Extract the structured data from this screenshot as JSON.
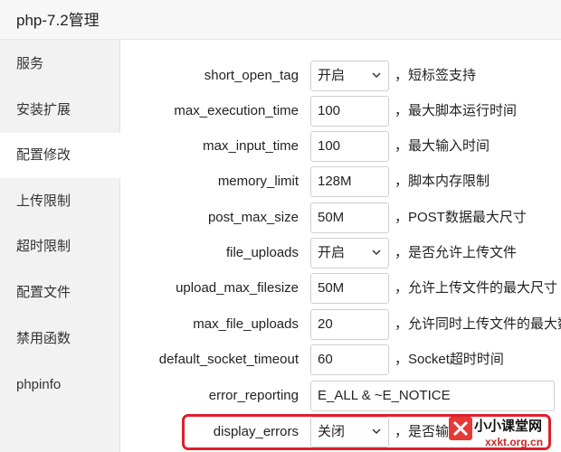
{
  "window": {
    "title": "php-7.2管理"
  },
  "sidebar": {
    "items": [
      {
        "label": "服务"
      },
      {
        "label": "安装扩展"
      },
      {
        "label": "配置修改",
        "active": true
      },
      {
        "label": "上传限制"
      },
      {
        "label": "超时限制"
      },
      {
        "label": "配置文件"
      },
      {
        "label": "禁用函数"
      },
      {
        "label": "phpinfo"
      }
    ]
  },
  "settings": [
    {
      "name": "short_open_tag",
      "value": "开启",
      "type": "select",
      "desc": "，短标签支持"
    },
    {
      "name": "max_execution_time",
      "value": "100",
      "type": "input",
      "desc": "，最大脚本运行时间"
    },
    {
      "name": "max_input_time",
      "value": "100",
      "type": "input",
      "desc": "，最大输入时间"
    },
    {
      "name": "memory_limit",
      "value": "128M",
      "type": "input",
      "desc": "，脚本内存限制"
    },
    {
      "name": "post_max_size",
      "value": "50M",
      "type": "input",
      "desc": "，POST数据最大尺寸"
    },
    {
      "name": "file_uploads",
      "value": "开启",
      "type": "select",
      "desc": "，是否允许上传文件"
    },
    {
      "name": "upload_max_filesize",
      "value": "50M",
      "type": "input",
      "desc": "，允许上传文件的最大尺寸"
    },
    {
      "name": "max_file_uploads",
      "value": "20",
      "type": "input",
      "desc": "，允许同时上传文件的最大数"
    },
    {
      "name": "default_socket_timeout",
      "value": "60",
      "type": "input",
      "desc": "，Socket超时时间"
    },
    {
      "name": "error_reporting",
      "value": "E_ALL & ~E_NOTICE",
      "type": "input-wide",
      "desc": ""
    },
    {
      "name": "display_errors",
      "value": "关闭",
      "type": "select",
      "desc": "，是否输"
    }
  ],
  "watermark": {
    "text": "小小课堂网",
    "url": "xxkt.org.cn"
  },
  "colors": {
    "highlight": "#e01e2b",
    "sidebar_bg": "#f2f2f2",
    "field_border": "#cfcfcf"
  }
}
